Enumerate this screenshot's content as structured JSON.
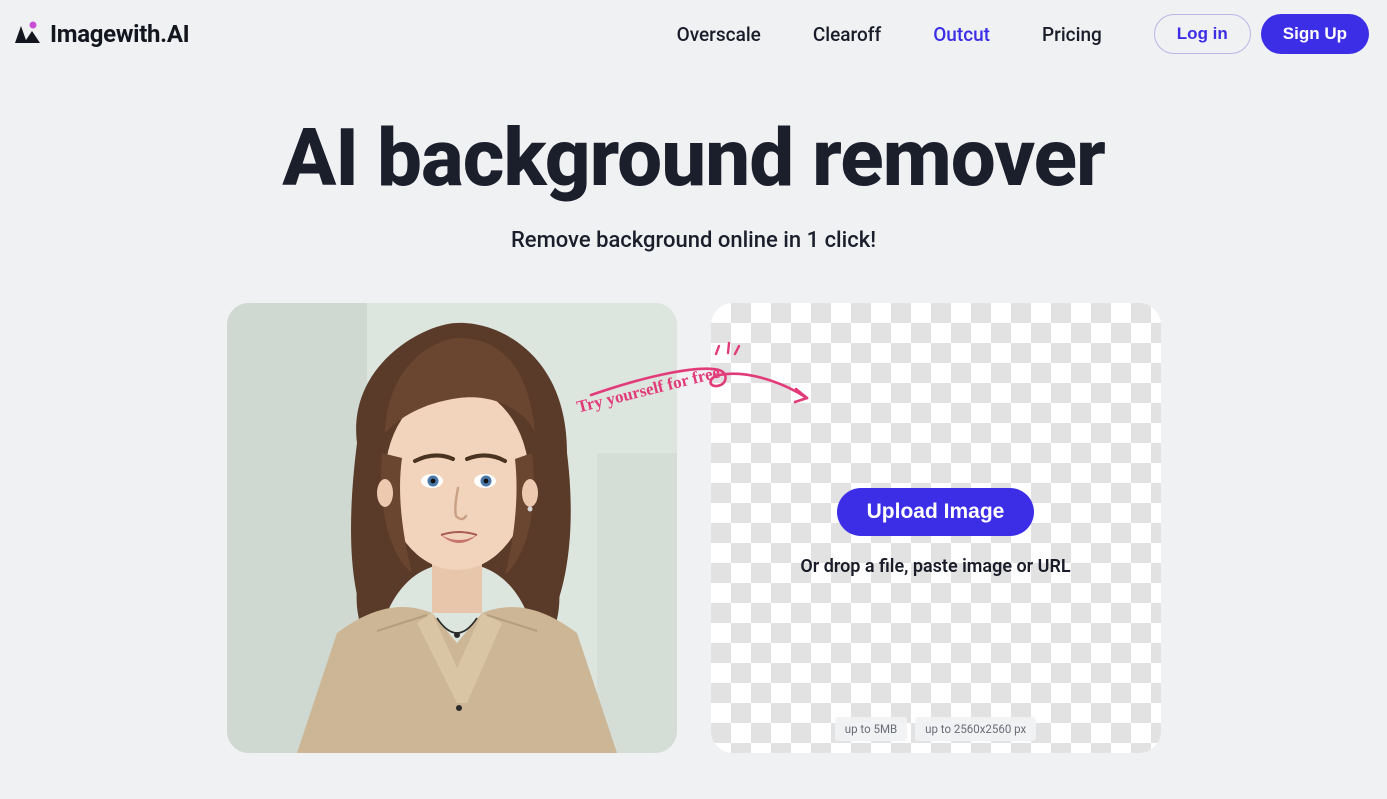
{
  "brand": {
    "name": "Imagewith.AI"
  },
  "nav": {
    "items": [
      {
        "label": "Overscale",
        "active": false
      },
      {
        "label": "Clearoff",
        "active": false
      },
      {
        "label": "Outcut",
        "active": true
      },
      {
        "label": "Pricing",
        "active": false
      }
    ],
    "login_label": "Log in",
    "signup_label": "Sign Up"
  },
  "hero": {
    "title": "AI background remover",
    "subtitle": "Remove background online in 1 click!"
  },
  "cta": {
    "try_text": "Try yourself for free",
    "upload_label": "Upload Image",
    "drop_hint": "Or drop a file, paste image or URL",
    "limits": [
      "up to 5MB",
      "up to 2560x2560 px"
    ]
  },
  "colors": {
    "accent": "#3c2ee6",
    "handwriting": "#e23b7a"
  }
}
